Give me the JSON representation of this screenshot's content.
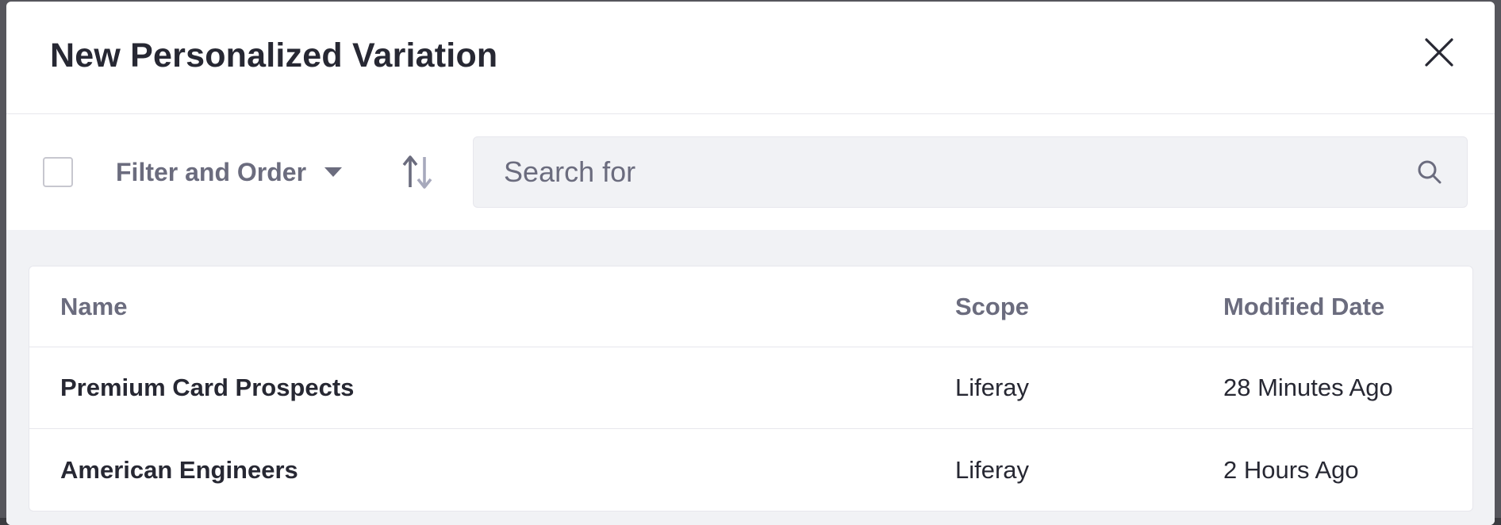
{
  "modal": {
    "title": "New Personalized Variation"
  },
  "toolbar": {
    "filter_label": "Filter and Order",
    "search_placeholder": "Search for"
  },
  "table": {
    "columns": [
      "Name",
      "Scope",
      "Modified Date"
    ],
    "rows": [
      {
        "name": "Premium Card Prospects",
        "scope": "Liferay",
        "modified": "28 Minutes Ago"
      },
      {
        "name": "American Engineers",
        "scope": "Liferay",
        "modified": "2 Hours Ago"
      }
    ]
  },
  "colors": {
    "title_text": "#272833",
    "secondary_text": "#6b6c7e",
    "panel_background": "#f1f2f5",
    "border": "#e7e7ed"
  },
  "icons": [
    "close-icon",
    "caret-down-icon",
    "order-arrows-icon",
    "search-icon"
  ]
}
